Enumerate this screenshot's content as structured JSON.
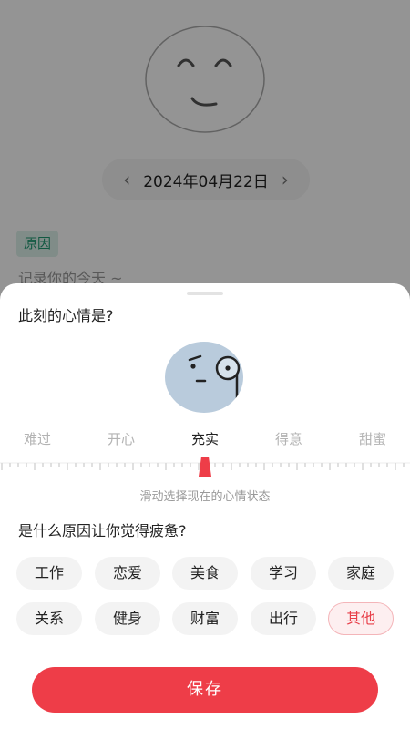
{
  "background": {
    "date": "2024年04月22日",
    "prev_icon": "chevron-left-icon",
    "next_icon": "chevron-right-icon",
    "reason_tag": "原因",
    "record_placeholder": "记录你的今天 ~"
  },
  "sheet": {
    "title": "此刻的心情是?",
    "moods": [
      {
        "label": "难过",
        "active": false
      },
      {
        "label": "开心",
        "active": false
      },
      {
        "label": "充实",
        "active": true
      },
      {
        "label": "得意",
        "active": false
      },
      {
        "label": "甜蜜",
        "active": false
      }
    ],
    "ruler_hint": "滑动选择现在的心情状态",
    "reason_question": "是什么原因让你觉得疲惫?",
    "reasons": [
      {
        "label": "工作",
        "selected": false
      },
      {
        "label": "恋爱",
        "selected": false
      },
      {
        "label": "美食",
        "selected": false
      },
      {
        "label": "学习",
        "selected": false
      },
      {
        "label": "家庭",
        "selected": false
      },
      {
        "label": "关系",
        "selected": false
      },
      {
        "label": "健身",
        "selected": false
      },
      {
        "label": "财富",
        "selected": false
      },
      {
        "label": "出行",
        "selected": false
      },
      {
        "label": "其他",
        "selected": true
      }
    ],
    "save_label": "保存"
  },
  "colors": {
    "accent": "#ee3d48",
    "face_fill": "#b9cbdc",
    "tag_green": "#1f9a73"
  }
}
